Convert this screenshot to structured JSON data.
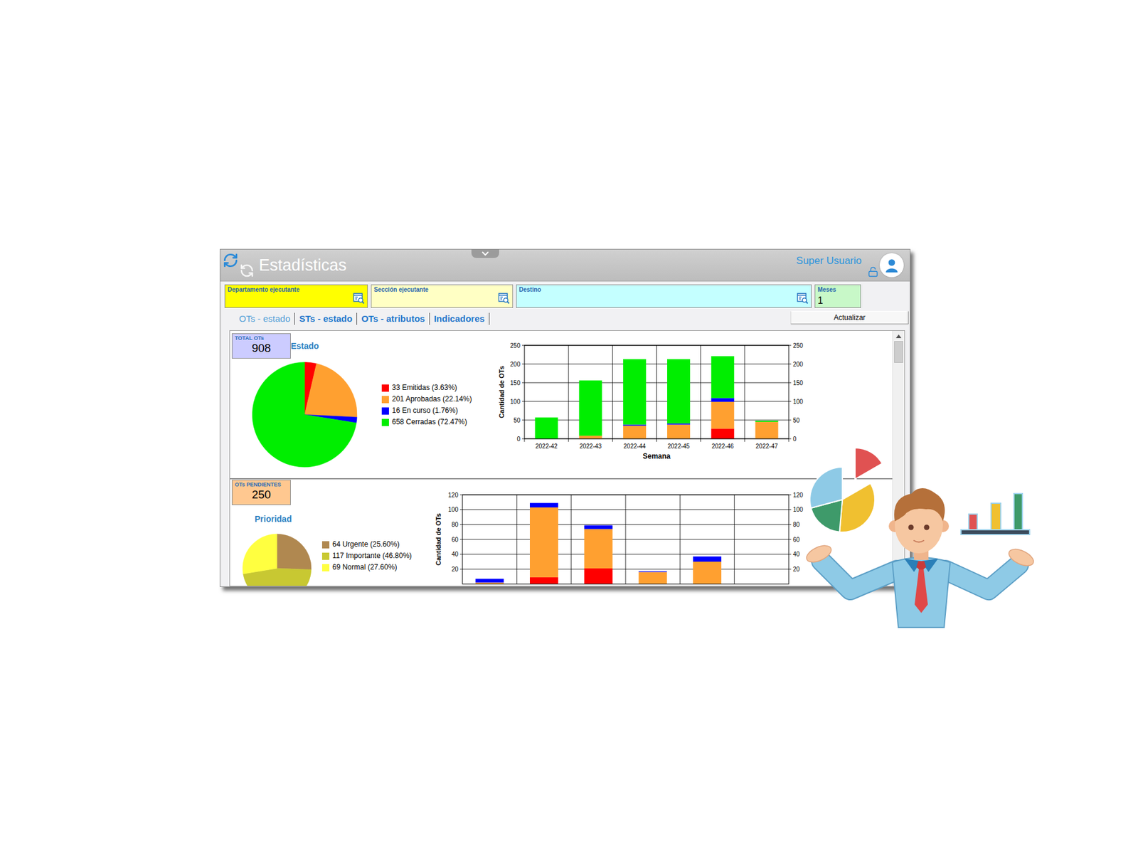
{
  "window": {
    "title": "Estadísticas"
  },
  "user": {
    "name": "Super Usuario"
  },
  "filters": [
    {
      "label": "Departamento ejecutante",
      "kind": "lookup",
      "color": "#ffff00"
    },
    {
      "label": "Sección ejecutante",
      "kind": "lookup",
      "color": "#ffffc4"
    },
    {
      "label": "Destino",
      "kind": "lookup",
      "color": "#c4ffff"
    },
    {
      "label": "Meses",
      "kind": "number",
      "value": "1",
      "color": "#c8f8c8"
    }
  ],
  "tabs": [
    {
      "label": "OTs - estado",
      "selected": true
    },
    {
      "label": "STs - estado",
      "selected": false
    },
    {
      "label": "OTs - atributos",
      "selected": false
    },
    {
      "label": "Indicadores",
      "selected": false
    }
  ],
  "refresh_button": "Actualizar",
  "scrollbar": {
    "level": 0
  },
  "sections": [
    {
      "kind": "beside",
      "counter": {
        "label": "TOTAL OTs",
        "value": "908",
        "color": "#ccccff"
      },
      "pie": {
        "title": "Estado",
        "slices": [
          {
            "label": "33 Emitidas (3.63%)",
            "value": 33,
            "color": "#ff0000"
          },
          {
            "label": "201 Aprobadas (22.14%)",
            "value": 201,
            "color": "#ffa030"
          },
          {
            "label": "16 En curso (1.76%)",
            "value": 16,
            "color": "#0000ff"
          },
          {
            "label": "658 Cerradas (72.47%)",
            "value": 658,
            "color": "#00ee00"
          }
        ]
      },
      "chart": {
        "y_label": "Cantidad de OTs",
        "x_label": "Semana",
        "y_ticks": [
          "0",
          "50",
          "100",
          "150",
          "200",
          "250"
        ],
        "categories": [
          "2022-42",
          "2022-43",
          "2022-44",
          "2022-45",
          "2022-46",
          "2022-47"
        ],
        "series": [
          {
            "color": "#ff0000",
            "values": [
              0,
              0,
              0,
              0,
              27,
              0
            ]
          },
          {
            "color": "#ffa030",
            "values": [
              0,
              8,
              35,
              38,
              72,
              45
            ]
          },
          {
            "color": "#0000ff",
            "values": [
              0,
              0,
              3,
              3,
              10,
              0
            ]
          },
          {
            "color": "#00ee00",
            "values": [
              57,
              148,
              175,
              172,
              112,
              3
            ]
          }
        ]
      }
    },
    {
      "kind": "below",
      "counter": {
        "label": "OTs PENDIENTES",
        "value": "250",
        "color": "#ffc890"
      },
      "pie": {
        "title": "Prioridad",
        "slices": [
          {
            "label": "64 Urgente (25.60%)",
            "value": 64,
            "color": "#b08850"
          },
          {
            "label": "117 Importante (46.80%)",
            "value": 117,
            "color": "#c8c832"
          },
          {
            "label": "69 Normal (27.60%)",
            "value": 69,
            "color": "#ffff40"
          }
        ]
      },
      "chart": {
        "y_label": "Cantidad de OTs",
        "y_ticks": [
          "20",
          "40",
          "60",
          "80",
          "100",
          "120"
        ],
        "series": [
          {
            "color": "#ff0000",
            "values": [
              0,
              9,
              21,
              0,
              0,
              0
            ]
          },
          {
            "color": "#ffa030",
            "values": [
              2,
              94,
              53,
              16,
              30,
              0
            ]
          },
          {
            "color": "#0000ff",
            "values": [
              5,
              6,
              5,
              1,
              7,
              0
            ]
          }
        ]
      }
    }
  ]
}
